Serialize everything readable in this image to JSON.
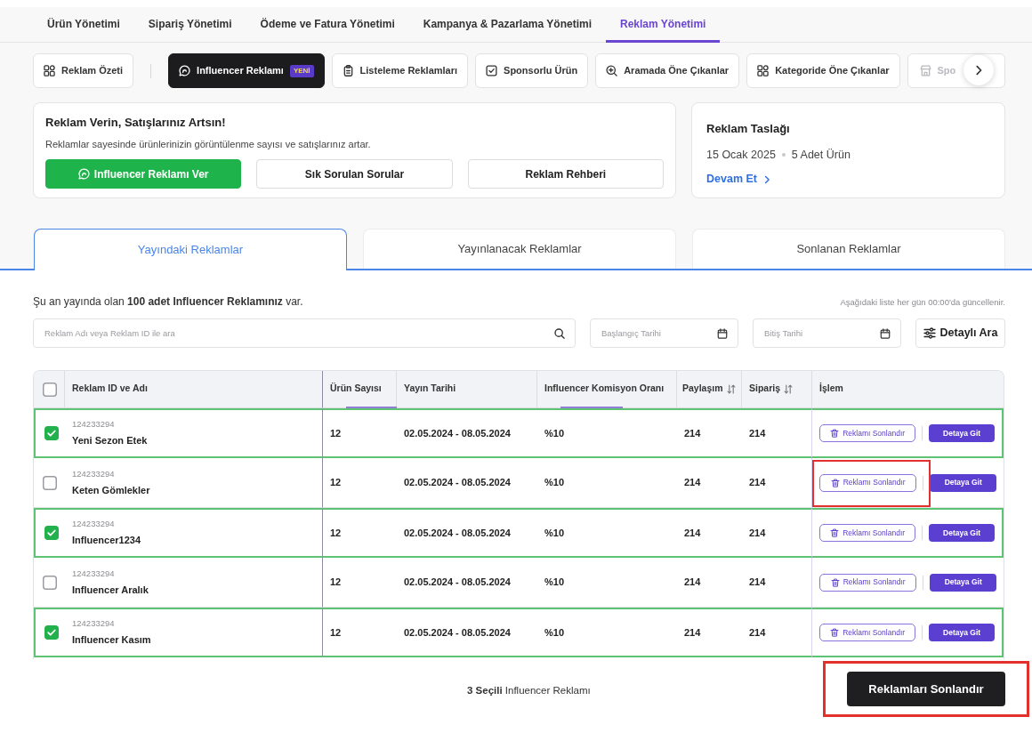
{
  "top_nav": [
    {
      "label": "Ürün Yönetimi",
      "selected": false
    },
    {
      "label": "Sipariş Yönetimi",
      "selected": false
    },
    {
      "label": "Ödeme ve Fatura Yönetimi",
      "selected": false
    },
    {
      "label": "Kampanya & Pazarlama Yönetimi",
      "selected": false
    },
    {
      "label": "Reklam Yönetimi",
      "selected": true
    }
  ],
  "ad_types": [
    {
      "label": "Reklam Özeti",
      "kind": "summary",
      "selected": false
    },
    {
      "label": "Influencer Reklamı",
      "kind": "type",
      "selected": true,
      "badge": "YENİ"
    },
    {
      "label": "Listeleme Reklamları",
      "kind": "type",
      "selected": false
    },
    {
      "label": "Sponsorlu Ürün",
      "kind": "type",
      "selected": false
    },
    {
      "label": "Aramada Öne Çıkanlar",
      "kind": "type",
      "selected": false
    },
    {
      "label": "Kategoride Öne Çıkanlar",
      "kind": "type",
      "selected": false
    },
    {
      "label": "Spo",
      "kind": "partial",
      "selected": false
    }
  ],
  "banner": {
    "title": "Reklam Verin, Satışlarınız Artsın!",
    "text": "Reklamlar sayesinde ürünlerinizin görüntülenme sayısı ve satışlarınız artar.",
    "buttons": [
      {
        "label": "Influencer Reklamı Ver",
        "kind": "primary"
      },
      {
        "label": "Sık Sorulan Sorular",
        "kind": "outline"
      },
      {
        "label": "Reklam Rehberi",
        "kind": "outline"
      }
    ]
  },
  "draft": {
    "title": "Reklam Taslağı",
    "date": "15 Ocak 2025",
    "count": "5 Adet Ürün",
    "link": "Devam Et"
  },
  "tabs": [
    {
      "label": "Yayındaki Reklamlar",
      "selected": true
    },
    {
      "label": "Yayınlanacak Reklamlar",
      "selected": false
    },
    {
      "label": "Sonlanan Reklamlar",
      "selected": false
    }
  ],
  "summary": {
    "text": "Şu an yayında olan **100 adet Influencer Reklamınız** var.",
    "note": "Aşağıdaki liste her gün 00:00'da güncellenir."
  },
  "filters": {
    "search": {
      "placeholder": "Reklam Adı veya Reklam ID ile ara"
    },
    "start_date": {
      "placeholder": "Başlangıç Tarihi"
    },
    "end_date": {
      "placeholder": "Bitiş Tarihi"
    },
    "advanced_search": "Detaylı Ara"
  },
  "table": {
    "select_all": {
      "checked": false
    },
    "columns": [
      {
        "label": "Reklam ID ve Adı",
        "sortable": false,
        "accent": false
      },
      {
        "label": "Ürün Sayısı",
        "sortable": false,
        "accent": true
      },
      {
        "label": "Yayın Tarihi",
        "sortable": false,
        "accent": false
      },
      {
        "label": "Influencer Komisyon Oranı",
        "sortable": false,
        "accent": true
      },
      {
        "label": "Paylaşım",
        "sortable": true,
        "accent": false
      },
      {
        "label": "Sipariş",
        "sortable": true,
        "accent": false
      },
      {
        "label": "İşlem",
        "sortable": false,
        "accent": false
      }
    ],
    "rows": [
      {
        "selected": true,
        "id": "124233294",
        "name": "Yeni Sezon Etek",
        "products": "12",
        "dates": "02.05.2024 - 08.05.2024",
        "commission": "%10",
        "shares": "214",
        "orders": "214",
        "end_button": {
          "label": "Reklamı Sonlandır",
          "highlighted": false
        },
        "detail_button": "Detaya Git"
      },
      {
        "selected": false,
        "id": "124233294",
        "name": "Keten Gömlekler",
        "products": "12",
        "dates": "02.05.2024 - 08.05.2024",
        "commission": "%10",
        "shares": "214",
        "orders": "214",
        "end_button": {
          "label": "Reklamı Sonlandır",
          "highlighted": true
        },
        "detail_button": "Detaya Git"
      },
      {
        "selected": true,
        "id": "124233294",
        "name": "Influencer1234",
        "products": "12",
        "dates": "02.05.2024 - 08.05.2024",
        "commission": "%10",
        "shares": "214",
        "orders": "214",
        "end_button": {
          "label": "Reklamı Sonlandır",
          "highlighted": false
        },
        "detail_button": "Detaya Git"
      },
      {
        "selected": false,
        "id": "124233294",
        "name": "Influencer Aralık",
        "products": "12",
        "dates": "02.05.2024 - 08.05.2024",
        "commission": "%10",
        "shares": "214",
        "orders": "214",
        "end_button": {
          "label": "Reklamı Sonlandır",
          "highlighted": false
        },
        "detail_button": "Detaya Git"
      },
      {
        "selected": true,
        "id": "124233294",
        "name": "Influencer Kasım",
        "products": "12",
        "dates": "02.05.2024 - 08.05.2024",
        "commission": "%10",
        "shares": "214",
        "orders": "214",
        "end_button": {
          "label": "Reklamı Sonlandır",
          "highlighted": false
        },
        "detail_button": "Detaya Git"
      }
    ]
  },
  "footer": {
    "selection": "**3 Seçili** Influencer Reklamı",
    "button": {
      "label": "Reklamları Sonlandır",
      "highlighted": true
    }
  }
}
